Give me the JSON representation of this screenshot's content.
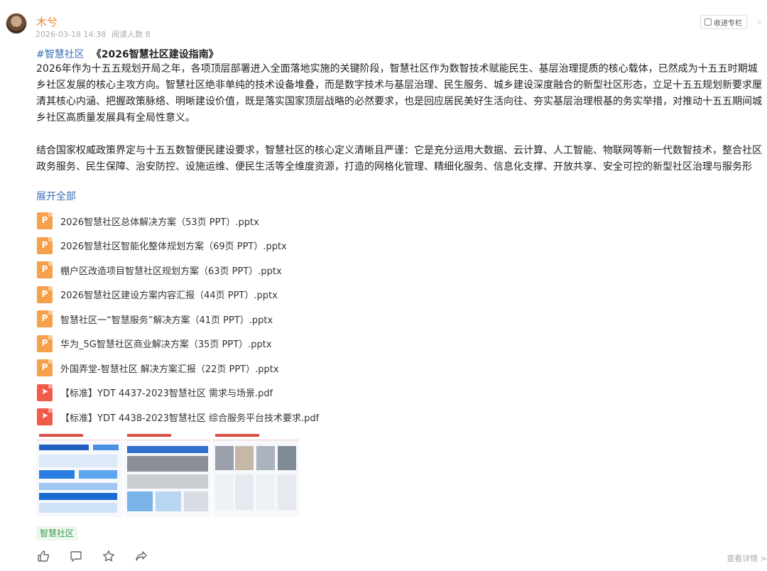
{
  "post": {
    "author": "木兮",
    "date": "2026-03-18 14:38",
    "read_count": "阅读人数 8",
    "collect_label": "收进专栏"
  },
  "title": {
    "hashtag": "#智慧社区",
    "book": "《2026智慧社区建设指南》"
  },
  "body": {
    "paragraphs": [
      "2026年作为十五五规划开局之年，各项顶层部署进入全面落地实施的关键阶段，智慧社区作为数智技术赋能民生、基层治理提质的核心载体，已然成为十五五时期城乡社区发展的核心主攻方向。智慧社区绝非单纯的技术设备堆叠，而是数字技术与基层治理、民生服务、城乡建设深度融合的新型社区形态，立足十五五规划新要求厘清其核心内涵、把握政策脉络、明晰建设价值，既是落实国家顶层战略的必然要求，也是回应居民美好生活向往、夯实基层治理根基的务实举措，对推动十五五期间城乡社区高质量发展具有全局性意义。",
      "结合国家权威政策界定与十五五数智便民建设要求，智慧社区的核心定义清晰且严谨：它是充分运用大数据、云计算、人工智能、物联网等新一代数智技术，整合社区政务服务、民生保障、治安防控、设施运维、便民生活等全维度资源，打造的网格化管理、精细化服务、信息化支撑、开放共享、安全可控的新型社区治理与服务形态。"
    ],
    "expand_label": "展开全部"
  },
  "files": [
    {
      "type": "ppt",
      "name": "2026智慧社区总体解决方案（53页 PPT）.pptx"
    },
    {
      "type": "ppt",
      "name": "2026智慧社区智能化整体规划方案（69页 PPT）.pptx"
    },
    {
      "type": "ppt",
      "name": "棚户区改造项目智慧社区规划方案（63页 PPT）.pptx"
    },
    {
      "type": "ppt",
      "name": "2026智慧社区建设方案内容汇报（44页 PPT）.pptx"
    },
    {
      "type": "ppt",
      "name": "智慧社区一“智慧服务”解决方案（41页 PPT）.pptx"
    },
    {
      "type": "ppt",
      "name": "华为_5G智慧社区商业解决方案（35页 PPT）.pptx"
    },
    {
      "type": "ppt",
      "name": "外国弄堂-智慧社区 解决方案汇报（22页 PPT）.pptx"
    },
    {
      "type": "pdf",
      "name": "【标准】YDT 4437-2023智慧社区 需求与场景.pdf"
    },
    {
      "type": "pdf",
      "name": "【标准】YDT 4438-2023智慧社区 综合服务平台技术要求.pdf"
    }
  ],
  "tag": "智慧社区",
  "actions": {
    "icons": [
      "thumbs-up-icon",
      "comment-icon",
      "star-icon",
      "share-icon"
    ],
    "details_label": "查看详情 >"
  },
  "colors": {
    "accent": "#3a6fb5",
    "author": "#e8862a",
    "ppt": "#f5a04a",
    "pdf": "#f15a4a",
    "tag_text": "#3d9a4a"
  }
}
